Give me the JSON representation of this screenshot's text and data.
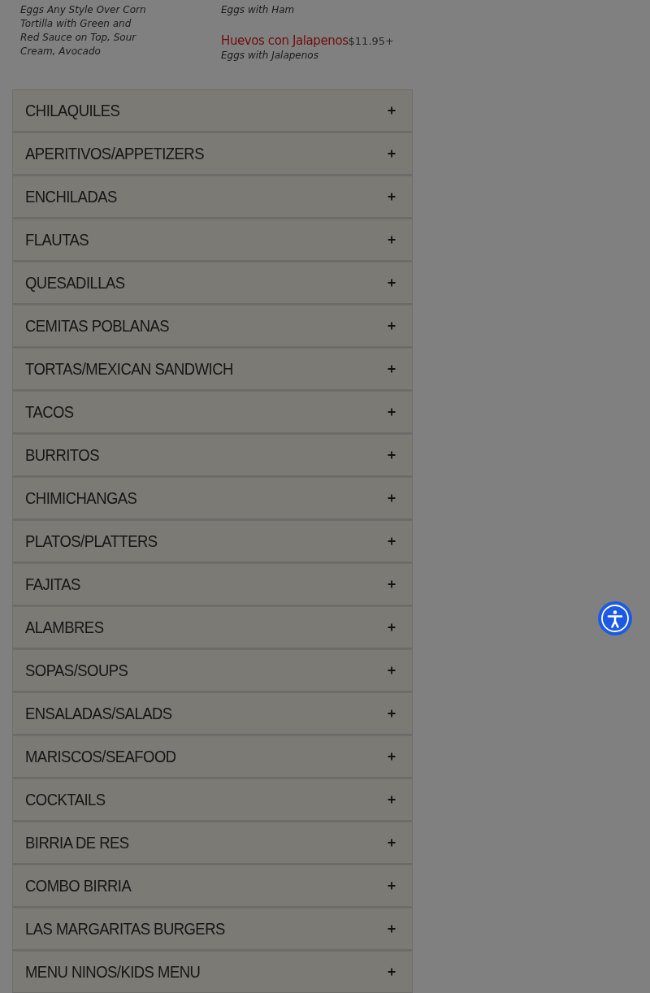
{
  "menu_items_columns": [
    {
      "items": [
        {
          "description": "Eggs Any Style Over Corn Tortilla with Green and Red Sauce on Top, Sour Cream, Avocado"
        }
      ]
    },
    {
      "items": [
        {
          "description": "Eggs with Ham"
        },
        {
          "name": "Huevos con Jalapenos",
          "price": "$11.95+",
          "description": "Eggs with Jalapenos"
        }
      ]
    }
  ],
  "categories": [
    {
      "label": "CHILAQUILES",
      "expanded": false
    },
    {
      "label": "APERITIVOS/APPETIZERS",
      "expanded": false
    },
    {
      "label": "ENCHILADAS",
      "expanded": false
    },
    {
      "label": "FLAUTAS",
      "expanded": false
    },
    {
      "label": "QUESADILLAS",
      "expanded": false
    },
    {
      "label": "CEMITAS POBLANAS",
      "expanded": false
    },
    {
      "label": "TORTAS/MEXICAN SANDWICH",
      "expanded": false
    },
    {
      "label": "TACOS",
      "expanded": false
    },
    {
      "label": "BURRITOS",
      "expanded": false
    },
    {
      "label": "CHIMICHANGAS",
      "expanded": false
    },
    {
      "label": "PLATOS/PLATTERS",
      "expanded": false
    },
    {
      "label": "FAJITAS",
      "expanded": false
    },
    {
      "label": "ALAMBRES",
      "expanded": false
    },
    {
      "label": "SOPAS/SOUPS",
      "expanded": false
    },
    {
      "label": "ENSALADAS/SALADS",
      "expanded": false
    },
    {
      "label": "MARISCOS/SEAFOOD",
      "expanded": false
    },
    {
      "label": "COCKTAILS",
      "expanded": false
    },
    {
      "label": "BIRRIA DE RES",
      "expanded": false
    },
    {
      "label": "COMBO BIRRIA",
      "expanded": false
    },
    {
      "label": "LAS MARGARITAS BURGERS",
      "expanded": false
    },
    {
      "label": "MENU NINOS/KIDS MENU",
      "expanded": false
    }
  ],
  "accessibility_button": {
    "kind": "accessibility"
  }
}
